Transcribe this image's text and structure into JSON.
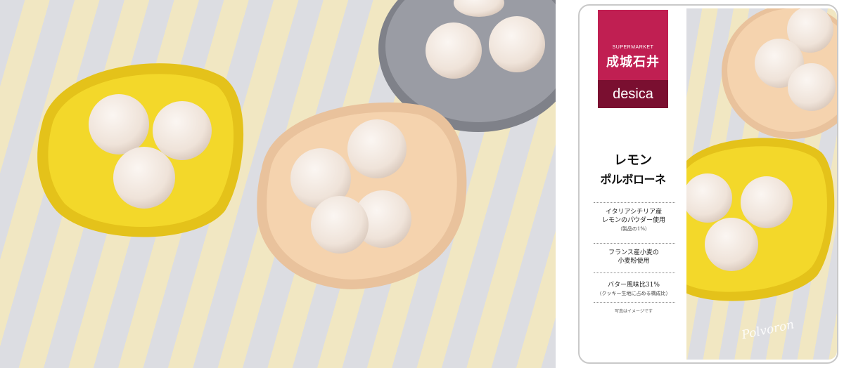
{
  "product": {
    "brand_super": "SUPERMARKET",
    "brand_name": "成城石井",
    "brand_line": "desica",
    "title_line1": "レモン",
    "title_line2": "ポルボローネ",
    "features": [
      {
        "main": "イタリアシチリア産\nレモンのパウダー使用",
        "note": "（製品の1%）"
      },
      {
        "main": "フランス産小麦の\n小麦粉使用",
        "note": ""
      },
      {
        "main": "バター風味比31%",
        "note": "（クッキー生地に占める構成比）"
      }
    ],
    "disclaimer": "写真はイメージです",
    "script_text": "Polvoron"
  },
  "colors": {
    "stripe_gray": "#dcdde2",
    "stripe_yellow": "#f1e7c2",
    "plate_yellow": "#f3d82a",
    "plate_peach": "#f5d3ae",
    "plate_gray": "#8f9199",
    "cookie": "#f3e9e2",
    "brand_red": "#c01f52",
    "brand_dark": "#7a0f30"
  },
  "photo": {
    "subject": "lemon polvoron cookies on colored plates",
    "plates": [
      "yellow-plate",
      "peach-plate",
      "gray-plate"
    ]
  }
}
